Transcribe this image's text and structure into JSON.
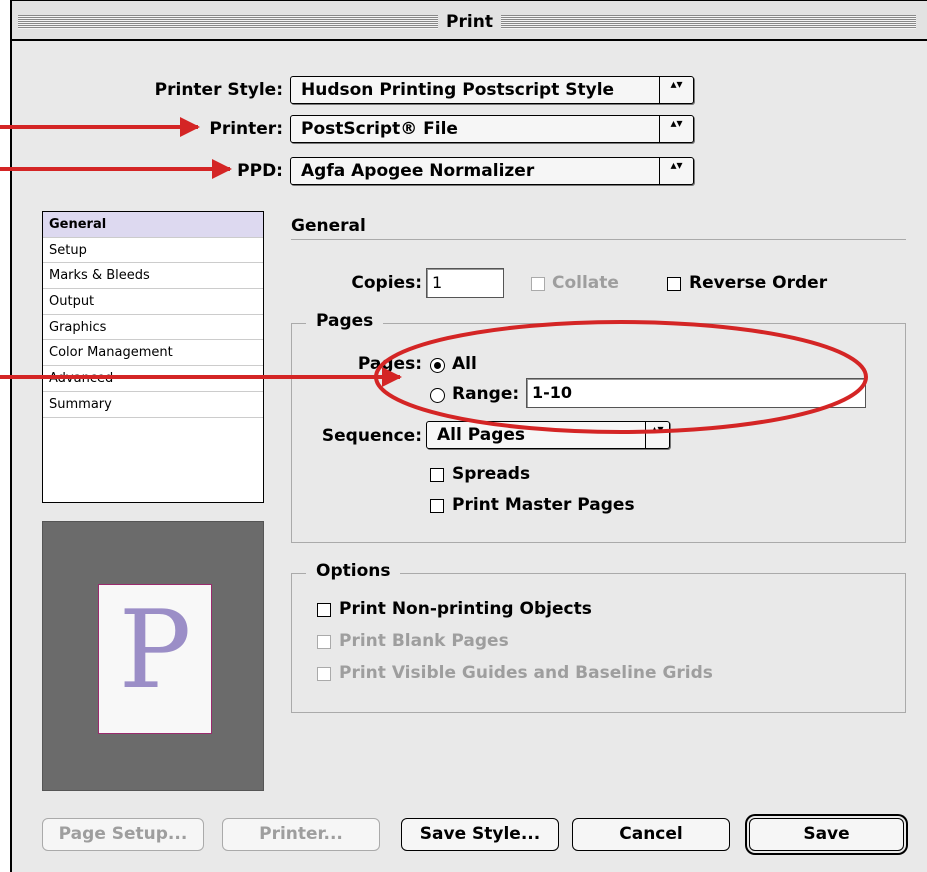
{
  "window": {
    "title": "Print"
  },
  "header": {
    "printer_style_label": "Printer Style:",
    "printer_style_value": "Hudson Printing Postscript Style",
    "printer_label": "Printer:",
    "printer_value": "PostScript® File",
    "ppd_label": "PPD:",
    "ppd_value": "Agfa Apogee Normalizer"
  },
  "sidebar": {
    "items": [
      {
        "label": "General",
        "selected": true
      },
      {
        "label": "Setup"
      },
      {
        "label": "Marks & Bleeds"
      },
      {
        "label": "Output"
      },
      {
        "label": "Graphics"
      },
      {
        "label": "Color Management"
      },
      {
        "label": "Advanced"
      },
      {
        "label": "Summary"
      }
    ]
  },
  "preview": {
    "letter": "P",
    "letter_color": "#9b8ec7"
  },
  "general": {
    "section_title": "General",
    "copies_label": "Copies:",
    "copies_value": "1",
    "collate_label": "Collate",
    "collate_disabled": true,
    "reverse_order_label": "Reverse Order",
    "reverse_order_checked": false
  },
  "pages": {
    "group_title": "Pages",
    "pages_label": "Pages:",
    "all_label": "All",
    "all_selected": true,
    "range_label": "Range:",
    "range_value": "1-10",
    "sequence_label": "Sequence:",
    "sequence_value": "All Pages",
    "spreads_label": "Spreads",
    "print_master_pages_label": "Print Master Pages"
  },
  "options": {
    "group_title": "Options",
    "non_printing_label": "Print Non-printing Objects",
    "blank_pages_label": "Print Blank Pages",
    "visible_guides_label": "Print Visible Guides and Baseline Grids"
  },
  "buttons": {
    "page_setup": "Page Setup...",
    "printer": "Printer...",
    "save_style": "Save Style...",
    "cancel": "Cancel",
    "save": "Save"
  },
  "colors": {
    "annotation_red": "#d42525",
    "sidebar_selection": "#ddd9f0"
  }
}
